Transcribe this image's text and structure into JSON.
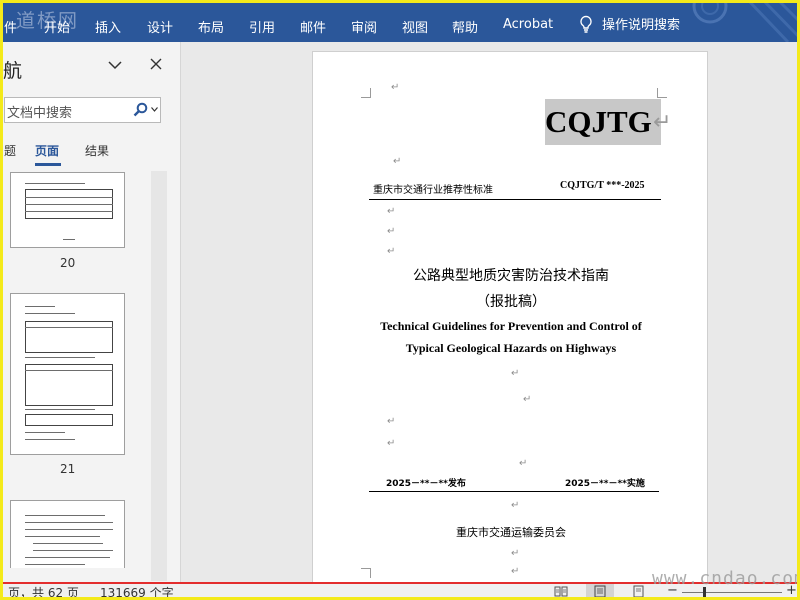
{
  "ribbon": {
    "logo": "道桥网",
    "tabs": [
      "件",
      "开始",
      "插入",
      "设计",
      "布局",
      "引用",
      "邮件",
      "审阅",
      "视图",
      "帮助",
      "Acrobat"
    ],
    "tell_me": "操作说明搜索",
    "accent": "#2b579a"
  },
  "nav": {
    "title": "航",
    "search_placeholder": "文档中搜索",
    "tabs": [
      "题",
      "页面",
      "结果"
    ],
    "pages": [
      "20",
      "21"
    ]
  },
  "document": {
    "badge": "CQJTG",
    "standard_type": "重庆市交通行业推荐性标准",
    "standard_code": "CQJTG/T ***-2025",
    "title_cn": "公路典型地质灾害防治技术指南",
    "subtitle_cn": "（报批稿）",
    "title_en_line1": "Technical Guidelines for Prevention and Control of",
    "title_en_line2": "Typical Geological Hazards on Highways",
    "publish_date": "2025－**－**发布",
    "implement_date": "2025－**－**实施",
    "issuer": "重庆市交通运输委员会",
    "para_mark": "↵"
  },
  "status": {
    "page_info": "页，共 62 页",
    "word_count": "131669 个字",
    "zoom_minus": "−",
    "zoom_plus": "+",
    "highlight_color": "#e32d2d"
  },
  "watermark": "www.cndao.com"
}
